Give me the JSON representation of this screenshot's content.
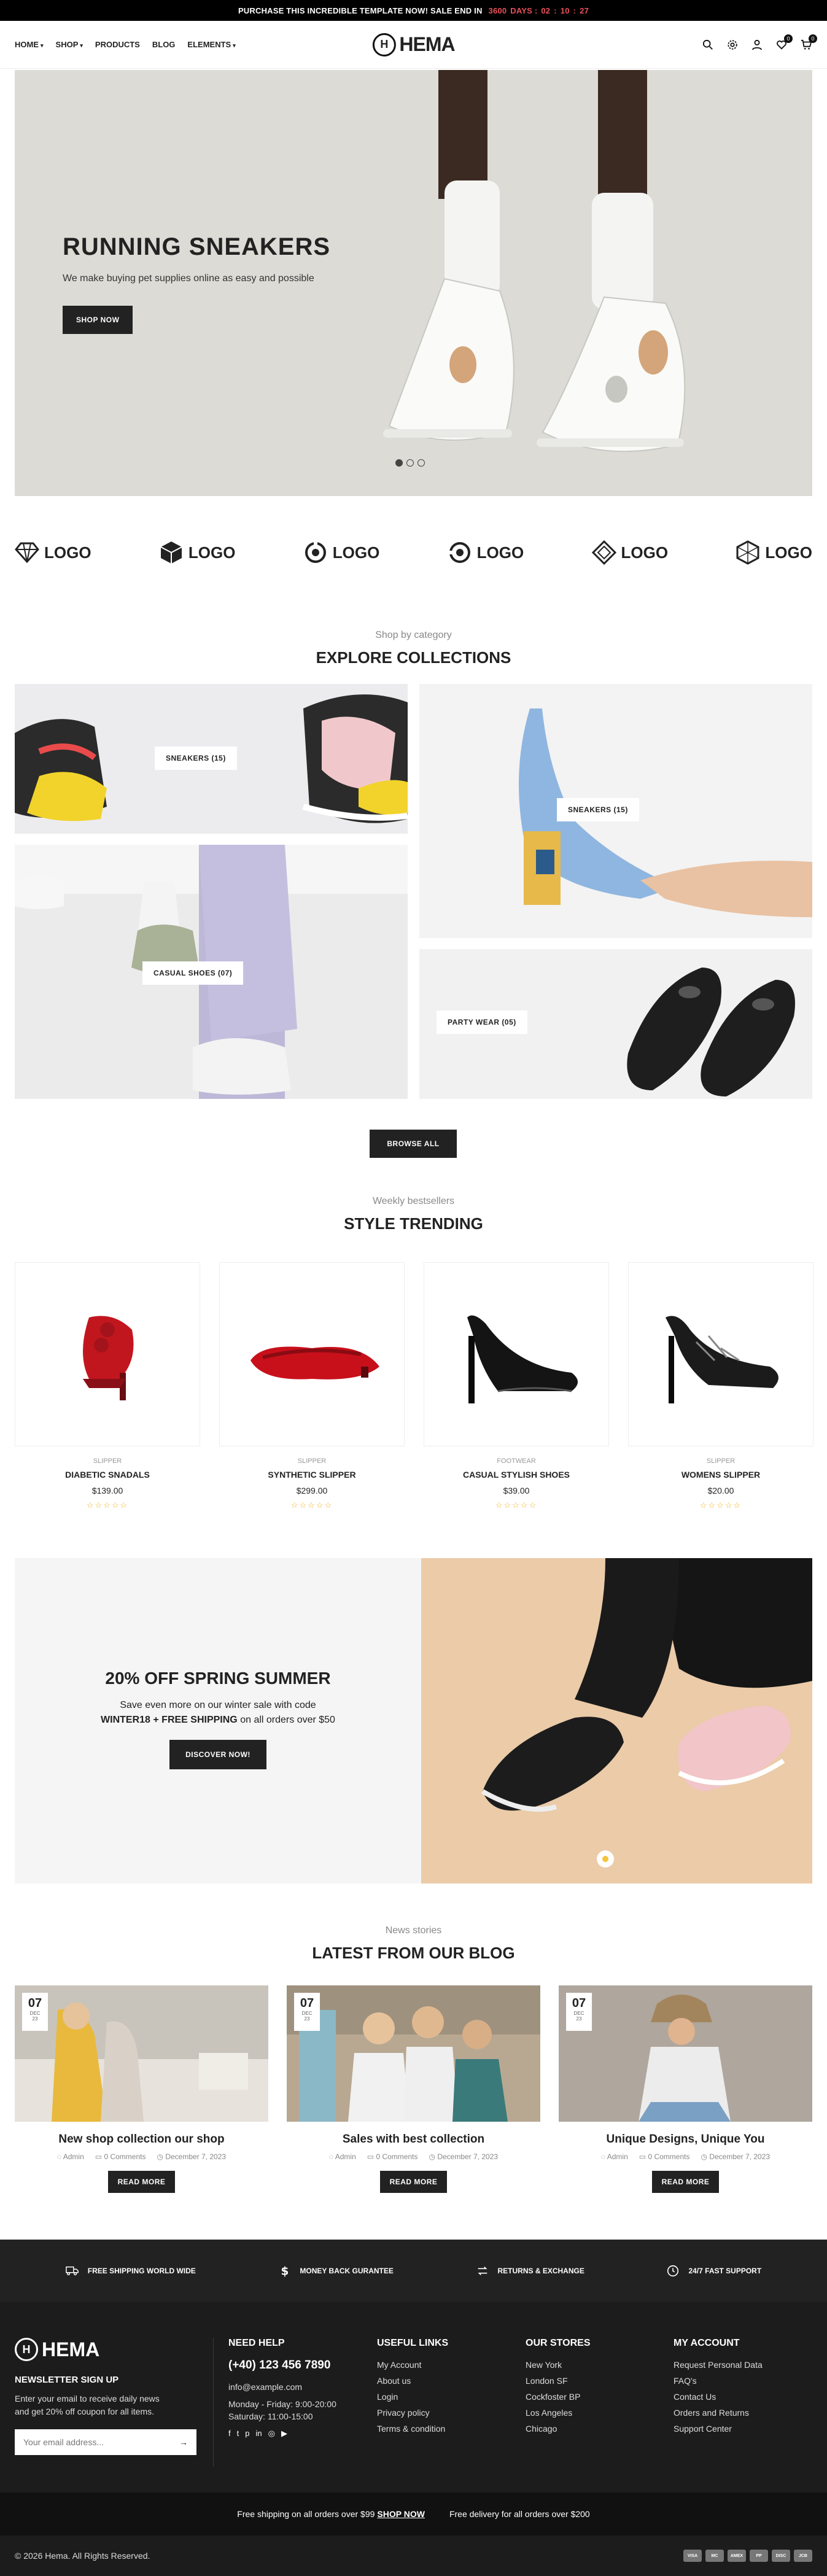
{
  "topbar": {
    "text": "PURCHASE THIS INCREDIBLE TEMPLATE NOW! SALE END IN",
    "days": "3600",
    "days_label": "DAYS :",
    "h": "02",
    "m": "10",
    "s": "27",
    "sep": ":"
  },
  "nav": [
    "HOME",
    "SHOP",
    "PRODUCTS",
    "BLOG",
    "ELEMENTS"
  ],
  "logo": {
    "text": "HEMA",
    "mark": "H"
  },
  "header_icons": {
    "wishlist_count": "0",
    "cart_count": "0"
  },
  "hero": {
    "title": "RUNNING SNEAKERS",
    "subtitle": "We make buying pet supplies online as easy and possible",
    "button": "SHOP NOW"
  },
  "brands": [
    "LOGO",
    "LOGO",
    "LOGO",
    "LOGO",
    "LOGO",
    "LOGO"
  ],
  "collections": {
    "subtitle": "Shop by category",
    "title": "EXPLORE COLLECTIONS",
    "items": [
      "SNEAKERS (15)",
      "SNEAKERS (15)",
      "CASUAL SHOES (07)",
      "PARTY WEAR (05)"
    ],
    "browse": "BROWSE ALL"
  },
  "trending": {
    "subtitle": "Weekly bestsellers",
    "title": "STYLE TRENDING",
    "products": [
      {
        "category": "SLIPPER",
        "name": "DIABETIC SNADALS",
        "price": "$139.00",
        "stars": "☆☆☆☆☆"
      },
      {
        "category": "SLIPPER",
        "name": "SYNTHETIC SLIPPER",
        "price": "$299.00",
        "stars": "☆☆☆☆☆"
      },
      {
        "category": "FOOTWEAR",
        "name": "CASUAL STYLISH SHOES",
        "price": "$39.00",
        "stars": "☆☆☆☆☆"
      },
      {
        "category": "SLIPPER",
        "name": "WOMENS SLIPPER",
        "price": "$20.00",
        "stars": "☆☆☆☆☆"
      }
    ]
  },
  "promo": {
    "title": "20% OFF SPRING SUMMER",
    "line1": "Save even more on our winter sale with code",
    "code": "WINTER18 + FREE SHIPPING",
    "line2_rest": " on all orders over $50",
    "button": "DISCOVER NOW!"
  },
  "blog": {
    "subtitle": "News stories",
    "title": "LATEST FROM OUR BLOG",
    "posts": [
      {
        "day": "07",
        "month": "DEC",
        "year": "23",
        "title": "New shop collection our shop",
        "author": "Admin",
        "comments": "0 Comments",
        "date": "December 7, 2023",
        "button": "READ MORE"
      },
      {
        "day": "07",
        "month": "DEC",
        "year": "23",
        "title": "Sales with best collection",
        "author": "Admin",
        "comments": "0 Comments",
        "date": "December 7, 2023",
        "button": "READ MORE"
      },
      {
        "day": "07",
        "month": "DEC",
        "year": "23",
        "title": "Unique Designs, Unique You",
        "author": "Admin",
        "comments": "0 Comments",
        "date": "December 7, 2023",
        "button": "READ MORE"
      }
    ]
  },
  "features": [
    "FREE SHIPPING WORLD WIDE",
    "MONEY BACK GURANTEE",
    "RETURNS & EXCHANGE",
    "24/7 FAST SUPPORT"
  ],
  "footer": {
    "newsletter_title": "NEWSLETTER SIGN UP",
    "newsletter_text1": "Enter your email to receive daily news",
    "newsletter_text2": "and get 20% off coupon for all items.",
    "email_placeholder": "Your email address...",
    "help_title": "NEED HELP",
    "phone": "(+40) 123 456 7890",
    "email": "info@example.com",
    "hours1": "Monday - Friday: 9:00-20:00",
    "hours2": "Saturday: 11:00-15:00",
    "useful_title": "USEFUL LINKS",
    "useful": [
      "My Account",
      "About us",
      "Login",
      "Privacy policy",
      "Terms & condition"
    ],
    "stores_title": "OUR STORES",
    "stores": [
      "New York",
      "London SF",
      "Cockfoster BP",
      "Los Angeles",
      "Chicago"
    ],
    "account_title": "MY ACCOUNT",
    "account": [
      "Request Personal Data",
      "FAQ's",
      "Contact Us",
      "Orders and Returns",
      "Support Center"
    ]
  },
  "bottom_bar": {
    "left": "Free shipping on all orders over $99",
    "shop": "SHOP NOW",
    "right": "Free delivery for all orders over $200"
  },
  "copyright": "© 2026 Hema. All Rights Reserved.",
  "payments": [
    "VISA",
    "MC",
    "AMEX",
    "PP",
    "DISC",
    "JCB"
  ]
}
